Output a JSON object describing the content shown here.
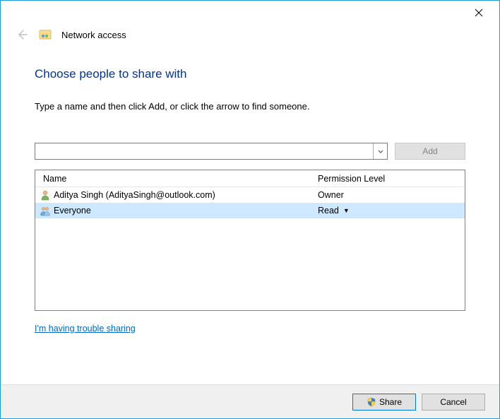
{
  "window": {
    "title": "Network access"
  },
  "heading": "Choose people to share with",
  "instruction": "Type a name and then click Add, or click the arrow to find someone.",
  "input": {
    "value": "",
    "add_label": "Add"
  },
  "columns": {
    "name": "Name",
    "permission": "Permission Level"
  },
  "rows": [
    {
      "name": "Aditya Singh (AdityaSingh@outlook.com)",
      "permission": "Owner",
      "type": "user",
      "selected": false
    },
    {
      "name": "Everyone",
      "permission": "Read",
      "type": "group",
      "selected": true
    }
  ],
  "help_link": "I'm having trouble sharing",
  "footer": {
    "share": "Share",
    "cancel": "Cancel"
  }
}
